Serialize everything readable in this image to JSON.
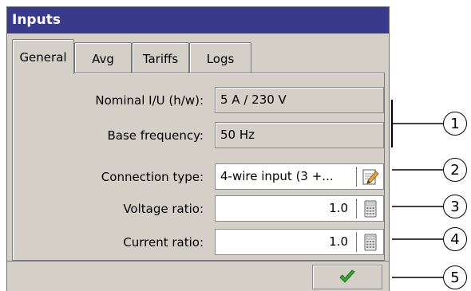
{
  "window": {
    "title": "Inputs"
  },
  "tabs": [
    {
      "label": "General",
      "active": true
    },
    {
      "label": "Avg",
      "active": false
    },
    {
      "label": "Tariffs",
      "active": false
    },
    {
      "label": "Logs",
      "active": false
    }
  ],
  "fields": {
    "nominal": {
      "label": "Nominal I/U (h/w):",
      "value": "5 A / 230 V"
    },
    "base_frequency": {
      "label": "Base frequency:",
      "value": "50 Hz"
    },
    "connection_type": {
      "label": "Connection type:",
      "value": "4-wire input (3 +..."
    },
    "voltage_ratio": {
      "label": "Voltage ratio:",
      "value": "1.0"
    },
    "current_ratio": {
      "label": "Current ratio:",
      "value": "1.0"
    }
  },
  "callouts": [
    "1",
    "2",
    "3",
    "4",
    "5"
  ],
  "icons": {
    "edit": "pencil-notepad-icon",
    "calculator": "calculator-icon",
    "ok": "checkmark-icon"
  },
  "colors": {
    "titlebar": "#3a3a8c",
    "checkmark": "#3aa63a"
  }
}
